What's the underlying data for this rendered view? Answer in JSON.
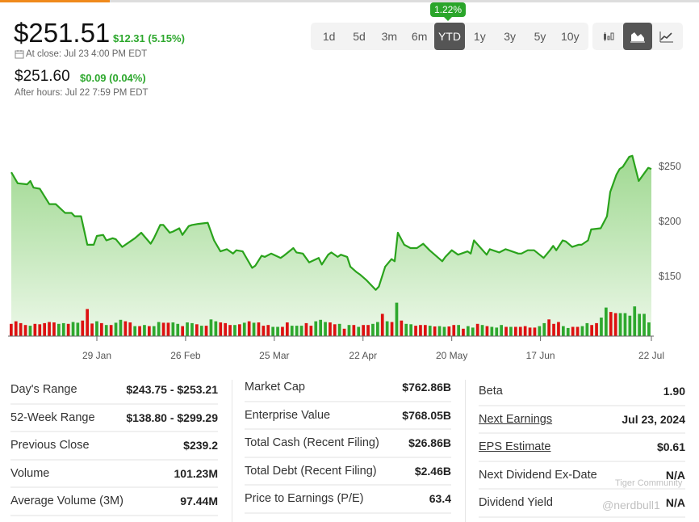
{
  "header": {
    "price": "$251.51",
    "change": "$12.31 (5.15%)",
    "close_time": "At close: Jul 23 4:00 PM EDT",
    "after_hours_price": "$251.60",
    "after_hours_change": "$0.09 (0.04%)",
    "after_hours_time": "After hours: Jul 22 7:59 PM EDT"
  },
  "ranges": {
    "items": [
      "1d",
      "5d",
      "3m",
      "6m",
      "YTD",
      "1y",
      "3y",
      "5y",
      "10y"
    ],
    "selected": "YTD",
    "tooltip": "1.22%"
  },
  "chart_types": {
    "items": [
      "candlestick-icon",
      "area-chart-icon",
      "line-chart-icon"
    ],
    "selected": "area-chart-icon"
  },
  "colors": {
    "up": "#2ea82e",
    "down": "#dd1111",
    "line": "#2aa31c",
    "active_tab": "#f08a1c"
  },
  "chart_data": {
    "type": "area",
    "x_ticks": [
      "29 Jan",
      "26 Feb",
      "25 Mar",
      "22 Apr",
      "20 May",
      "17 Jun",
      "22 Jul"
    ],
    "x_tick_dates": [
      "2024-01-29",
      "2024-02-26",
      "2024-03-25",
      "2024-04-22",
      "2024-05-20",
      "2024-06-17",
      "2024-07-22"
    ],
    "y_ticks": [
      "$150",
      "$200",
      "$250"
    ],
    "y_tick_values": [
      150,
      200,
      250
    ],
    "grid": false,
    "series": [
      {
        "points": [
          [
            "2024-01-02",
            244
          ],
          [
            "2024-01-04",
            234
          ],
          [
            "2024-01-07",
            233
          ],
          [
            "2024-01-08",
            236
          ],
          [
            "2024-01-09",
            230
          ],
          [
            "2024-01-11",
            229
          ],
          [
            "2024-01-14",
            215
          ],
          [
            "2024-01-16",
            215
          ],
          [
            "2024-01-19",
            207
          ],
          [
            "2024-01-21",
            207
          ],
          [
            "2024-01-22",
            204
          ],
          [
            "2024-01-24",
            204
          ],
          [
            "2024-01-26",
            178
          ],
          [
            "2024-01-28",
            178
          ],
          [
            "2024-01-29",
            186
          ],
          [
            "2024-01-31",
            187
          ],
          [
            "2024-02-01",
            182
          ],
          [
            "2024-02-03",
            184
          ],
          [
            "2024-02-04",
            183
          ],
          [
            "2024-02-06",
            176
          ],
          [
            "2024-02-08",
            180
          ],
          [
            "2024-02-10",
            184
          ],
          [
            "2024-02-12",
            189
          ],
          [
            "2024-02-15",
            179
          ],
          [
            "2024-02-16",
            184
          ],
          [
            "2024-02-18",
            196
          ],
          [
            "2024-02-19",
            196
          ],
          [
            "2024-02-21",
            189
          ],
          [
            "2024-02-22",
            190
          ],
          [
            "2024-02-24",
            193
          ],
          [
            "2024-02-25",
            187
          ],
          [
            "2024-02-27",
            195
          ],
          [
            "2024-02-28",
            196
          ],
          [
            "2024-03-01",
            197
          ],
          [
            "2024-03-04",
            198
          ],
          [
            "2024-03-06",
            182
          ],
          [
            "2024-03-08",
            172
          ],
          [
            "2024-03-10",
            174
          ],
          [
            "2024-03-12",
            170
          ],
          [
            "2024-03-13",
            173
          ],
          [
            "2024-03-15",
            172
          ],
          [
            "2024-03-18",
            157
          ],
          [
            "2024-03-19",
            159
          ],
          [
            "2024-03-21",
            168
          ],
          [
            "2024-03-22",
            167
          ],
          [
            "2024-03-24",
            170
          ],
          [
            "2024-03-27",
            166
          ],
          [
            "2024-03-28",
            168
          ],
          [
            "2024-03-31",
            175
          ],
          [
            "2024-04-01",
            171
          ],
          [
            "2024-04-03",
            170
          ],
          [
            "2024-04-05",
            162
          ],
          [
            "2024-04-08",
            166
          ],
          [
            "2024-04-09",
            160
          ],
          [
            "2024-04-11",
            169
          ],
          [
            "2024-04-12",
            171
          ],
          [
            "2024-04-14",
            167
          ],
          [
            "2024-04-15",
            169
          ],
          [
            "2024-04-17",
            167
          ],
          [
            "2024-04-18",
            158
          ],
          [
            "2024-04-20",
            153
          ],
          [
            "2024-04-21",
            151
          ],
          [
            "2024-04-23",
            146
          ],
          [
            "2024-04-24",
            143
          ],
          [
            "2024-04-26",
            137
          ],
          [
            "2024-04-27",
            140
          ],
          [
            "2024-04-29",
            158
          ],
          [
            "2024-05-01",
            165
          ],
          [
            "2024-05-02",
            163
          ],
          [
            "2024-05-03",
            189
          ],
          [
            "2024-05-05",
            178
          ],
          [
            "2024-05-07",
            175
          ],
          [
            "2024-05-09",
            175
          ],
          [
            "2024-05-11",
            179
          ],
          [
            "2024-05-13",
            173
          ],
          [
            "2024-05-17",
            163
          ],
          [
            "2024-05-18",
            167
          ],
          [
            "2024-05-20",
            173
          ],
          [
            "2024-05-22",
            169
          ],
          [
            "2024-05-23",
            170
          ],
          [
            "2024-05-25",
            172
          ],
          [
            "2024-05-26",
            170
          ],
          [
            "2024-05-27",
            182
          ],
          [
            "2024-05-31",
            169
          ],
          [
            "2024-06-01",
            174
          ],
          [
            "2024-06-04",
            171
          ],
          [
            "2024-06-06",
            174
          ],
          [
            "2024-06-07",
            173
          ],
          [
            "2024-06-10",
            170
          ],
          [
            "2024-06-11",
            170
          ],
          [
            "2024-06-13",
            173
          ],
          [
            "2024-06-15",
            173
          ],
          [
            "2024-06-18",
            166
          ],
          [
            "2024-06-20",
            173
          ],
          [
            "2024-06-21",
            177
          ],
          [
            "2024-06-22",
            173
          ],
          [
            "2024-06-24",
            182
          ],
          [
            "2024-06-25",
            181
          ],
          [
            "2024-06-27",
            176
          ],
          [
            "2024-06-29",
            178
          ],
          [
            "2024-06-30",
            178
          ],
          [
            "2024-07-02",
            182
          ],
          [
            "2024-07-03",
            192
          ],
          [
            "2024-07-06",
            193
          ],
          [
            "2024-07-08",
            204
          ],
          [
            "2024-07-09",
            226
          ],
          [
            "2024-07-11",
            242
          ],
          [
            "2024-07-12",
            247
          ],
          [
            "2024-07-13",
            249
          ],
          [
            "2024-07-15",
            258
          ],
          [
            "2024-07-16",
            259
          ],
          [
            "2024-07-18",
            236
          ],
          [
            "2024-07-20",
            244
          ],
          [
            "2024-07-21",
            248
          ],
          [
            "2024-07-22",
            247
          ]
        ]
      }
    ],
    "volume_relative": [
      0.33,
      0.4,
      0.35,
      0.3,
      0.28,
      0.33,
      0.32,
      0.35,
      0.38,
      0.37,
      0.33,
      0.35,
      0.33,
      0.38,
      0.36,
      0.42,
      0.73,
      0.34,
      0.4,
      0.35,
      0.3,
      0.3,
      0.36,
      0.44,
      0.4,
      0.37,
      0.27,
      0.27,
      0.3,
      0.27,
      0.27,
      0.38,
      0.36,
      0.36,
      0.37,
      0.33,
      0.27,
      0.37,
      0.35,
      0.32,
      0.28,
      0.28,
      0.45,
      0.4,
      0.37,
      0.35,
      0.3,
      0.3,
      0.32,
      0.36,
      0.4,
      0.36,
      0.37,
      0.28,
      0.3,
      0.25,
      0.25,
      0.25,
      0.37,
      0.28,
      0.28,
      0.28,
      0.35,
      0.28,
      0.4,
      0.44,
      0.38,
      0.37,
      0.32,
      0.33,
      0.2,
      0.3,
      0.3,
      0.25,
      0.3,
      0.3,
      0.33,
      0.38,
      0.6,
      0.4,
      0.38,
      0.9,
      0.42,
      0.33,
      0.32,
      0.28,
      0.3,
      0.3,
      0.28,
      0.26,
      0.27,
      0.25,
      0.26,
      0.3,
      0.3,
      0.2,
      0.27,
      0.23,
      0.33,
      0.3,
      0.27,
      0.25,
      0.23,
      0.3,
      0.25,
      0.25,
      0.25,
      0.25,
      0.27,
      0.23,
      0.23,
      0.27,
      0.35,
      0.45,
      0.33,
      0.38,
      0.27,
      0.22,
      0.25,
      0.25,
      0.27,
      0.35,
      0.3,
      0.35,
      0.5,
      0.77,
      0.65,
      0.62,
      0.62,
      0.62,
      0.55,
      0.8,
      0.6,
      0.6,
      0.37
    ],
    "volume_direction": "dddduddddduuduudddududuuddududuudduuduududuudddudududdduudduuudduuuddudududduudududuuddduduudduduududuuududdddduuddduudduudduudduuuuuuudddu"
  },
  "stats": {
    "col1": [
      {
        "label": "Day's Range",
        "value": "$243.75 - $253.21"
      },
      {
        "label": "52-Week Range",
        "value": "$138.80 - $299.29"
      },
      {
        "label": "Previous Close",
        "value": "$239.2"
      },
      {
        "label": "Volume",
        "value": "101.23M"
      },
      {
        "label": "Average Volume (3M)",
        "value": "97.44M"
      }
    ],
    "col2": [
      {
        "label": "Market Cap",
        "value": "$762.86B"
      },
      {
        "label": "Enterprise Value",
        "value": "$768.05B"
      },
      {
        "label": "Total Cash (Recent Filing)",
        "value": "$26.86B"
      },
      {
        "label": "Total Debt (Recent Filing)",
        "value": "$2.46B"
      },
      {
        "label": "Price to Earnings (P/E)",
        "value": "63.4"
      }
    ],
    "col3": [
      {
        "label": "Beta",
        "value": "1.90"
      },
      {
        "label": "Next Earnings",
        "value": "Jul 23, 2024"
      },
      {
        "label": "EPS Estimate",
        "value": "$0.61"
      },
      {
        "label": "Next Dividend Ex-Date",
        "value": "N/A"
      },
      {
        "label": "Dividend Yield",
        "value": "N/A"
      }
    ]
  },
  "watermark": {
    "brand": "Tiger Community",
    "handle": "@nerdbull1"
  }
}
